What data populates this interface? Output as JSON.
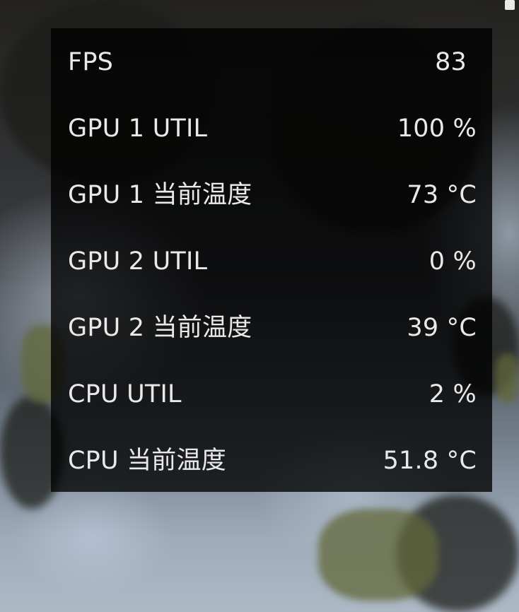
{
  "overlay": {
    "metrics": [
      {
        "label": "FPS",
        "value": "83"
      },
      {
        "label": "GPU 1 UTIL",
        "value": "100 %"
      },
      {
        "label": "GPU 1 当前温度",
        "value": "73 °C"
      },
      {
        "label": "GPU 2 UTIL",
        "value": "0 %"
      },
      {
        "label": "GPU 2 当前温度",
        "value": "39 °C"
      },
      {
        "label": "CPU UTIL",
        "value": "2 %"
      },
      {
        "label": "CPU 当前温度",
        "value": "51.8 °C"
      }
    ]
  },
  "colors": {
    "panel_background": "#000000",
    "text": "#e9e9e9"
  }
}
